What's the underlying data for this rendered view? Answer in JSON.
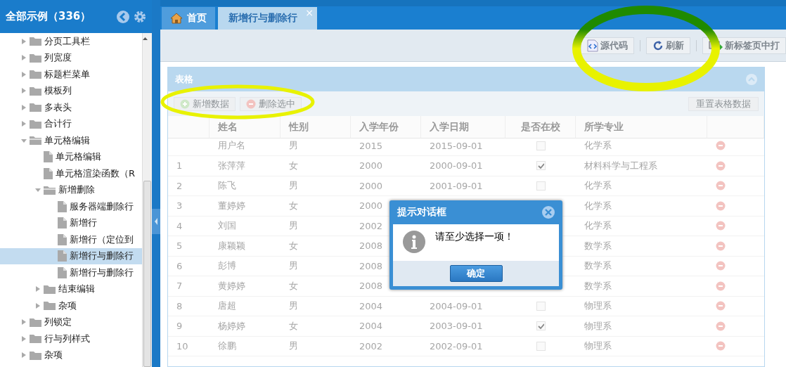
{
  "sidebar": {
    "title": "全部示例（336）",
    "items": [
      {
        "label": "分页工具栏",
        "kind": "folder",
        "expanded": false,
        "selected": false
      },
      {
        "label": "列宽度",
        "kind": "folder",
        "expanded": false,
        "selected": false
      },
      {
        "label": "标题栏菜单",
        "kind": "folder",
        "expanded": false,
        "selected": false
      },
      {
        "label": "模板列",
        "kind": "folder",
        "expanded": false,
        "selected": false
      },
      {
        "label": "多表头",
        "kind": "folder",
        "expanded": false,
        "selected": false
      },
      {
        "label": "合计行",
        "kind": "folder",
        "expanded": false,
        "selected": false
      },
      {
        "label": "单元格编辑",
        "kind": "folder",
        "expanded": true,
        "selected": false,
        "children": [
          {
            "label": "单元格编辑",
            "kind": "file",
            "selected": false
          },
          {
            "label": "单元格渲染函数（R",
            "kind": "file",
            "selected": false
          },
          {
            "label": "新增删除",
            "kind": "folder",
            "expanded": true,
            "selected": false,
            "children": [
              {
                "label": "服务器端删除行",
                "kind": "file",
                "selected": false
              },
              {
                "label": "新增行",
                "kind": "file",
                "selected": false
              },
              {
                "label": "新增行（定位到",
                "kind": "file",
                "selected": false
              },
              {
                "label": "新增行与删除行",
                "kind": "file",
                "selected": true
              },
              {
                "label": "新增行与删除行",
                "kind": "file",
                "selected": false
              }
            ]
          },
          {
            "label": "结束编辑",
            "kind": "folder",
            "expanded": false,
            "selected": false
          },
          {
            "label": "杂项",
            "kind": "folder",
            "expanded": false,
            "selected": false
          }
        ]
      },
      {
        "label": "列锁定",
        "kind": "folder",
        "expanded": false,
        "selected": false
      },
      {
        "label": "行与列样式",
        "kind": "folder",
        "expanded": false,
        "selected": false
      },
      {
        "label": "杂项",
        "kind": "folder",
        "expanded": false,
        "selected": false
      }
    ]
  },
  "tabs": [
    {
      "label": "首页",
      "kind": "home",
      "selected": false
    },
    {
      "label": "新增行与删除行",
      "kind": "page",
      "selected": true,
      "close": "×"
    }
  ],
  "toolbar": [
    {
      "label": "源代码",
      "kind": "code"
    },
    {
      "label": "刷新",
      "kind": "refresh"
    },
    {
      "label": "新标签页中打",
      "kind": "newtab"
    }
  ],
  "panel": {
    "title": "表格",
    "buttons": [
      {
        "label": "新增数据",
        "kind": "add"
      },
      {
        "label": "删除选中",
        "kind": "remove"
      },
      {
        "label": "重置表格数据",
        "kind": "reset"
      }
    ],
    "table": {
      "columns": [
        "姓名",
        "性别",
        "入学年份",
        "入学日期",
        "是否在校",
        "所学专业"
      ],
      "rows": [
        {
          "number": "",
          "name": "用户名",
          "gender": "男",
          "year": "2015",
          "date": "2015-09-01",
          "checked": false,
          "major": "化学系"
        },
        {
          "number": "1",
          "name": "张萍萍",
          "gender": "女",
          "year": "2000",
          "date": "2000-09-01",
          "checked": true,
          "major": "材料科学与工程系"
        },
        {
          "number": "2",
          "name": "陈飞",
          "gender": "男",
          "year": "2000",
          "date": "2001-09-01",
          "checked": false,
          "major": "化学系"
        },
        {
          "number": "3",
          "name": "董婷婷",
          "gender": "女",
          "year": "2000",
          "major": "化学系"
        },
        {
          "number": "4",
          "name": "刘国",
          "gender": "男",
          "year": "2002",
          "major": "化学系"
        },
        {
          "number": "5",
          "name": "康颖颖",
          "gender": "女",
          "year": "2008",
          "major": "数学系"
        },
        {
          "number": "6",
          "name": "彭博",
          "gender": "男",
          "year": "2008",
          "major": "数学系"
        },
        {
          "number": "7",
          "name": "黄婷婷",
          "gender": "女",
          "year": "2008",
          "major": "数学系"
        },
        {
          "number": "8",
          "name": "唐超",
          "gender": "男",
          "year": "2004",
          "date": "2004-09-01",
          "checked": false,
          "major": "物理系"
        },
        {
          "number": "9",
          "name": "杨婷婷",
          "gender": "女",
          "year": "2004",
          "date": "2003-09-01",
          "checked": true,
          "major": "物理系"
        },
        {
          "number": "10",
          "name": "徐鹏",
          "gender": "男",
          "year": "2002",
          "date": "2002-09-01",
          "checked": false,
          "major": "物理系"
        }
      ]
    }
  },
  "dialog": {
    "title": "提示对话框",
    "message": "请至少选择一项！",
    "button": "确定"
  }
}
